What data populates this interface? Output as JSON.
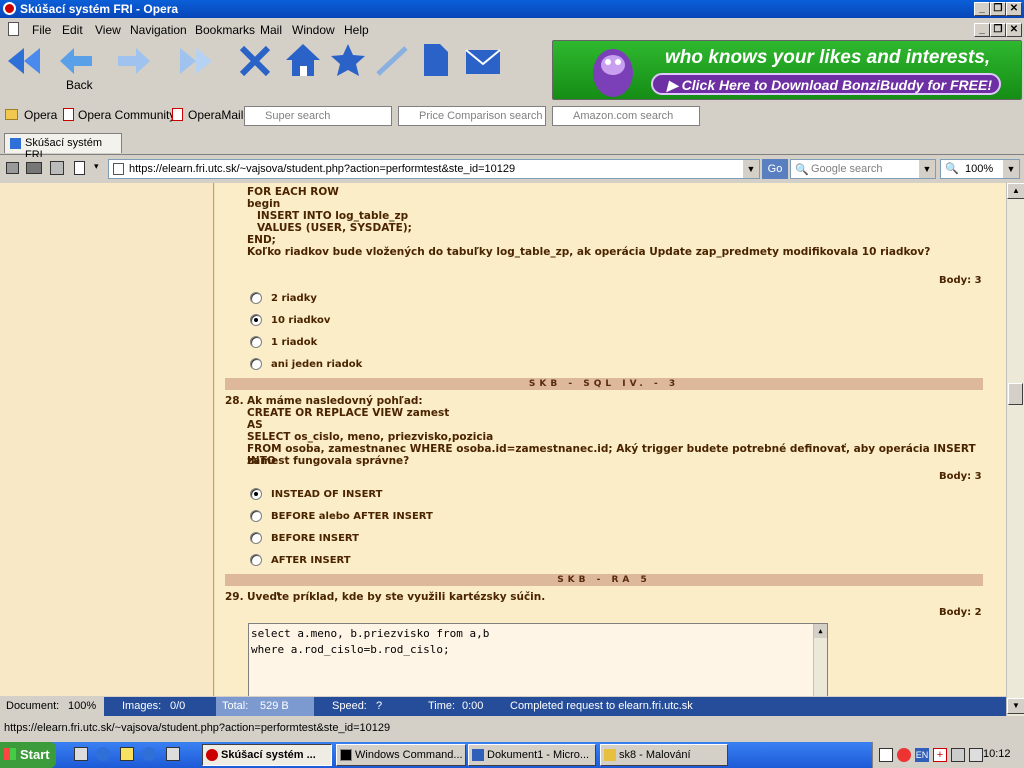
{
  "window": {
    "title": "Skúšací systém FRI - Opera"
  },
  "menu": {
    "file": "File",
    "edit": "Edit",
    "view": "View",
    "navigation": "Navigation",
    "bookmarks": "Bookmarks",
    "mail": "Mail",
    "window": "Window",
    "help": "Help"
  },
  "toolbar": {
    "back_label": "Back"
  },
  "banner": {
    "line1": "who knows your likes and interests,",
    "line2": "Click Here to Download BonziBuddy for FREE!"
  },
  "personalbar": {
    "opera": "Opera",
    "community": "Opera Community",
    "mail": "OperaMail",
    "s1": "Super search",
    "s2": "Price Comparison search",
    "s3": "Amazon.com search"
  },
  "tab": {
    "label": "Skúšací systém FRI"
  },
  "address": {
    "url": "https://elearn.fri.utc.sk/~vajsova/student.php?action=performtest&ste_id=10129",
    "go": "Go",
    "search_placeholder": "Google search",
    "zoom": "100%"
  },
  "q27": {
    "code1": "FOR EACH ROW",
    "code2": "begin",
    "code3": "INSERT INTO log_table_zp",
    "code4": "VALUES (USER, SYSDATE);",
    "code5": "END;",
    "text": "Koľko riadkov bude vložených do tabuľky log_table_zp, ak operácia Update zap_predmety modifikovala 10 riadkov?",
    "points": "Body: 3",
    "options": [
      "2 riadky",
      "10 riadkov",
      "1 riadok",
      "ani jeden riadok"
    ]
  },
  "section1": "SKB - SQL IV. - 3",
  "q28": {
    "num": "28.",
    "l1": "Ak máme nasledovný pohľad:",
    "l2": "CREATE OR REPLACE VIEW zamest",
    "l3": "AS",
    "l4": "SELECT os_cislo, meno, priezvisko,pozicia",
    "l5": "FROM osoba, zamestnanec WHERE osoba.id=zamestnanec.id; Aký trigger budete potrebné definovať, aby operácia INSERT INTO",
    "l6": "zamest fungovala správne?",
    "points": "Body: 3",
    "options": [
      "INSTEAD OF INSERT",
      "BEFORE alebo AFTER INSERT",
      "BEFORE INSERT",
      "AFTER INSERT"
    ]
  },
  "section2": "SKB - RA 5",
  "q29": {
    "num": "29.",
    "text": "Uveďte príklad, kde by ste využili kartézsky súčin.",
    "points": "Body: 2",
    "answer_l1": "select a.meno, b.priezvisko from a,b",
    "answer_l2": "where a.rod_cislo=b.rod_cislo;"
  },
  "status": {
    "document": "Document:",
    "document_val": "100%",
    "images": "Images:",
    "images_val": "0/0",
    "total": "Total:",
    "total_val": "529 B",
    "speed": "Speed:",
    "speed_val": "?",
    "time": "Time:",
    "time_val": "0:00",
    "message": "Completed request to elearn.fri.utc.sk"
  },
  "url_status": "https://elearn.fri.utc.sk/~vajsova/student.php?action=performtest&ste_id=10129",
  "taskbar": {
    "start": "Start",
    "t1": "Skúšací systém ...",
    "t2": "Windows Command...",
    "t3": "Dokument1 - Micro...",
    "t4": "sk8 - Malování",
    "clock": "10:12",
    "lang": "EN"
  }
}
